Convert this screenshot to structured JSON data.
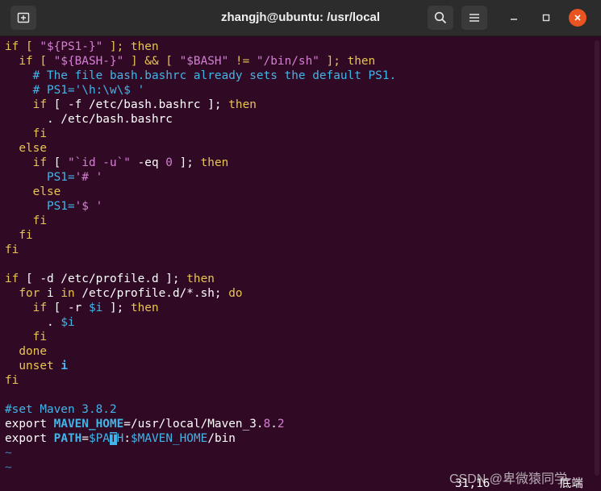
{
  "window": {
    "title": "zhangjh@ubuntu: /usr/local"
  },
  "icons": {
    "new_tab": "new-tab-icon",
    "search": "search-icon",
    "menu": "hamburger-menu-icon",
    "minimize": "minimize-icon",
    "maximize": "maximize-icon",
    "close": "close-icon"
  },
  "colors": {
    "terminal_bg": "#300a24",
    "titlebar_bg": "#2c2c2c",
    "keyword": "#e8c452",
    "string": "#d47fd4",
    "comment": "#41b4e8",
    "close_button": "#e95420"
  },
  "editor": {
    "l01": {
      "a": "if [ ",
      "b": "\"${PS1-}\"",
      "c": " ]; ",
      "d": "then"
    },
    "l02": {
      "a": "  if [ ",
      "b": "\"${BASH-}\"",
      "c": " ] && [ ",
      "d": "\"$BASH\"",
      "e": " != ",
      "f": "\"/bin/sh\"",
      "g": " ]; ",
      "h": "then"
    },
    "l03": "    # The file bash.bashrc already sets the default PS1.",
    "l04": "    # PS1='\\h:\\w\\$ '",
    "l05": {
      "a": "    if",
      "b": " [ -f /etc/bash.bashrc ]; ",
      "c": "then"
    },
    "l06": "      . /etc/bash.bashrc",
    "l07": "    fi",
    "l08": "  else",
    "l09": {
      "a": "    if",
      "b": " [ ",
      "c": "\"`id -u`\"",
      "d": " -eq ",
      "e": "0",
      "f": " ]; ",
      "g": "then"
    },
    "l10": {
      "a": "      PS1=",
      "b": "'# '"
    },
    "l11": "    else",
    "l12": {
      "a": "      PS1=",
      "b": "'$ '"
    },
    "l13": "    fi",
    "l14": "  fi",
    "l15": "fi",
    "l16": {
      "a": "if",
      "b": " [ -d /etc/profile.d ]; ",
      "c": "then"
    },
    "l17": {
      "a": "  for",
      "b": " i ",
      "c": "in",
      "d": " /etc/profile.d/*.sh; ",
      "e": "do"
    },
    "l18": {
      "a": "    if",
      "b": " [ -r ",
      "c": "$i",
      "d": " ]; ",
      "e": "then"
    },
    "l19": {
      "a": "      . ",
      "b": "$i"
    },
    "l20": "    fi",
    "l21": "  done",
    "l22": {
      "a": "  unset",
      "b": " i"
    },
    "l23": "fi",
    "l24": "#set Maven 3.8.2",
    "l25": {
      "a": "export ",
      "b": "MAVEN_HOME",
      "c": "=/usr/local/Maven_3.",
      "d": "8",
      "e": ".",
      "f": "2"
    },
    "l26": {
      "a": "export ",
      "b": "PATH",
      "c": "=",
      "d": "$PA",
      "e": "T",
      "f": "H",
      "g": ":",
      "h": "$MAVEN_HOME",
      "i": "/bin"
    },
    "tilde": "~"
  },
  "status": {
    "position": "31,16",
    "scroll": "底端"
  },
  "watermark": "CSDN @卑微猿同学"
}
